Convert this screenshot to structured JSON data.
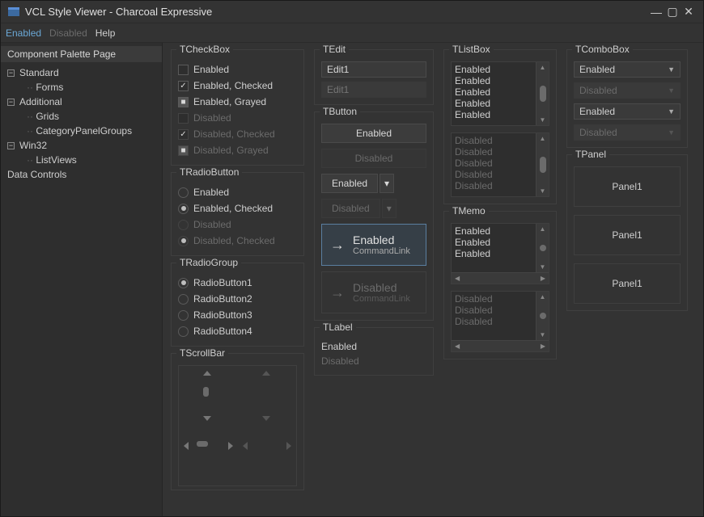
{
  "window": {
    "title": "VCL Style Viewer - Charcoal Expressive"
  },
  "menu": {
    "enabled": "Enabled",
    "disabled": "Disabled",
    "help": "Help"
  },
  "sidebar": {
    "header": "Component Palette Page",
    "nodes": [
      {
        "label": "Standard",
        "children": [
          "Forms"
        ]
      },
      {
        "label": "Additional",
        "children": [
          "Grids",
          "CategoryPanelGroups"
        ]
      },
      {
        "label": "Win32",
        "children": [
          "ListViews"
        ]
      },
      {
        "label": "Data Controls",
        "children": []
      }
    ]
  },
  "checkbox": {
    "title": "TCheckBox",
    "items": [
      {
        "label": "Enabled",
        "checked": false,
        "dim": false
      },
      {
        "label": "Enabled, Checked",
        "checked": true,
        "dim": false
      },
      {
        "label": "Enabled, Grayed",
        "grayed": true,
        "dim": false
      },
      {
        "label": "Disabled",
        "checked": false,
        "dim": true
      },
      {
        "label": "Disabled, Checked",
        "checked": true,
        "dim": true
      },
      {
        "label": "Disabled, Grayed",
        "grayed": true,
        "dim": true
      }
    ]
  },
  "radio": {
    "title": "TRadioButton",
    "items": [
      {
        "label": "Enabled",
        "checked": false,
        "dim": false
      },
      {
        "label": "Enabled, Checked",
        "checked": true,
        "dim": false
      },
      {
        "label": "Disabled",
        "checked": false,
        "dim": true
      },
      {
        "label": "Disabled, Checked",
        "checked": true,
        "dim": true
      }
    ]
  },
  "radiogroup": {
    "title": "TRadioGroup",
    "items": [
      "RadioButton1",
      "RadioButton2",
      "RadioButton3",
      "RadioButton4"
    ],
    "selected": 0
  },
  "scrollbar": {
    "title": "TScrollBar"
  },
  "edit": {
    "title": "TEdit",
    "value": "Edit1",
    "placeholder": "Edit1"
  },
  "button": {
    "title": "TButton",
    "enabled": "Enabled",
    "disabled": "Disabled",
    "cmd_enabled": "Enabled",
    "cmd_disabled": "Disabled",
    "cmd_sub": "CommandLink"
  },
  "label": {
    "title": "TLabel",
    "enabled": "Enabled",
    "disabled": "Disabled"
  },
  "listbox": {
    "title": "TListBox",
    "enabled_items": [
      "Enabled",
      "Enabled",
      "Enabled",
      "Enabled",
      "Enabled"
    ],
    "disabled_items": [
      "Disabled",
      "Disabled",
      "Disabled",
      "Disabled",
      "Disabled"
    ]
  },
  "memo": {
    "title": "TMemo",
    "enabled_lines": [
      "Enabled",
      "Enabled",
      "Enabled"
    ],
    "disabled_lines": [
      "Disabled",
      "Disabled",
      "Disabled"
    ]
  },
  "combo": {
    "title": "TComboBox",
    "items": [
      {
        "label": "Enabled",
        "dim": false
      },
      {
        "label": "Disabled",
        "dim": true
      },
      {
        "label": "Enabled",
        "dim": false
      },
      {
        "label": "Disabled",
        "dim": true
      }
    ]
  },
  "panel": {
    "title": "TPanel",
    "labels": [
      "Panel1",
      "Panel1",
      "Panel1"
    ]
  }
}
